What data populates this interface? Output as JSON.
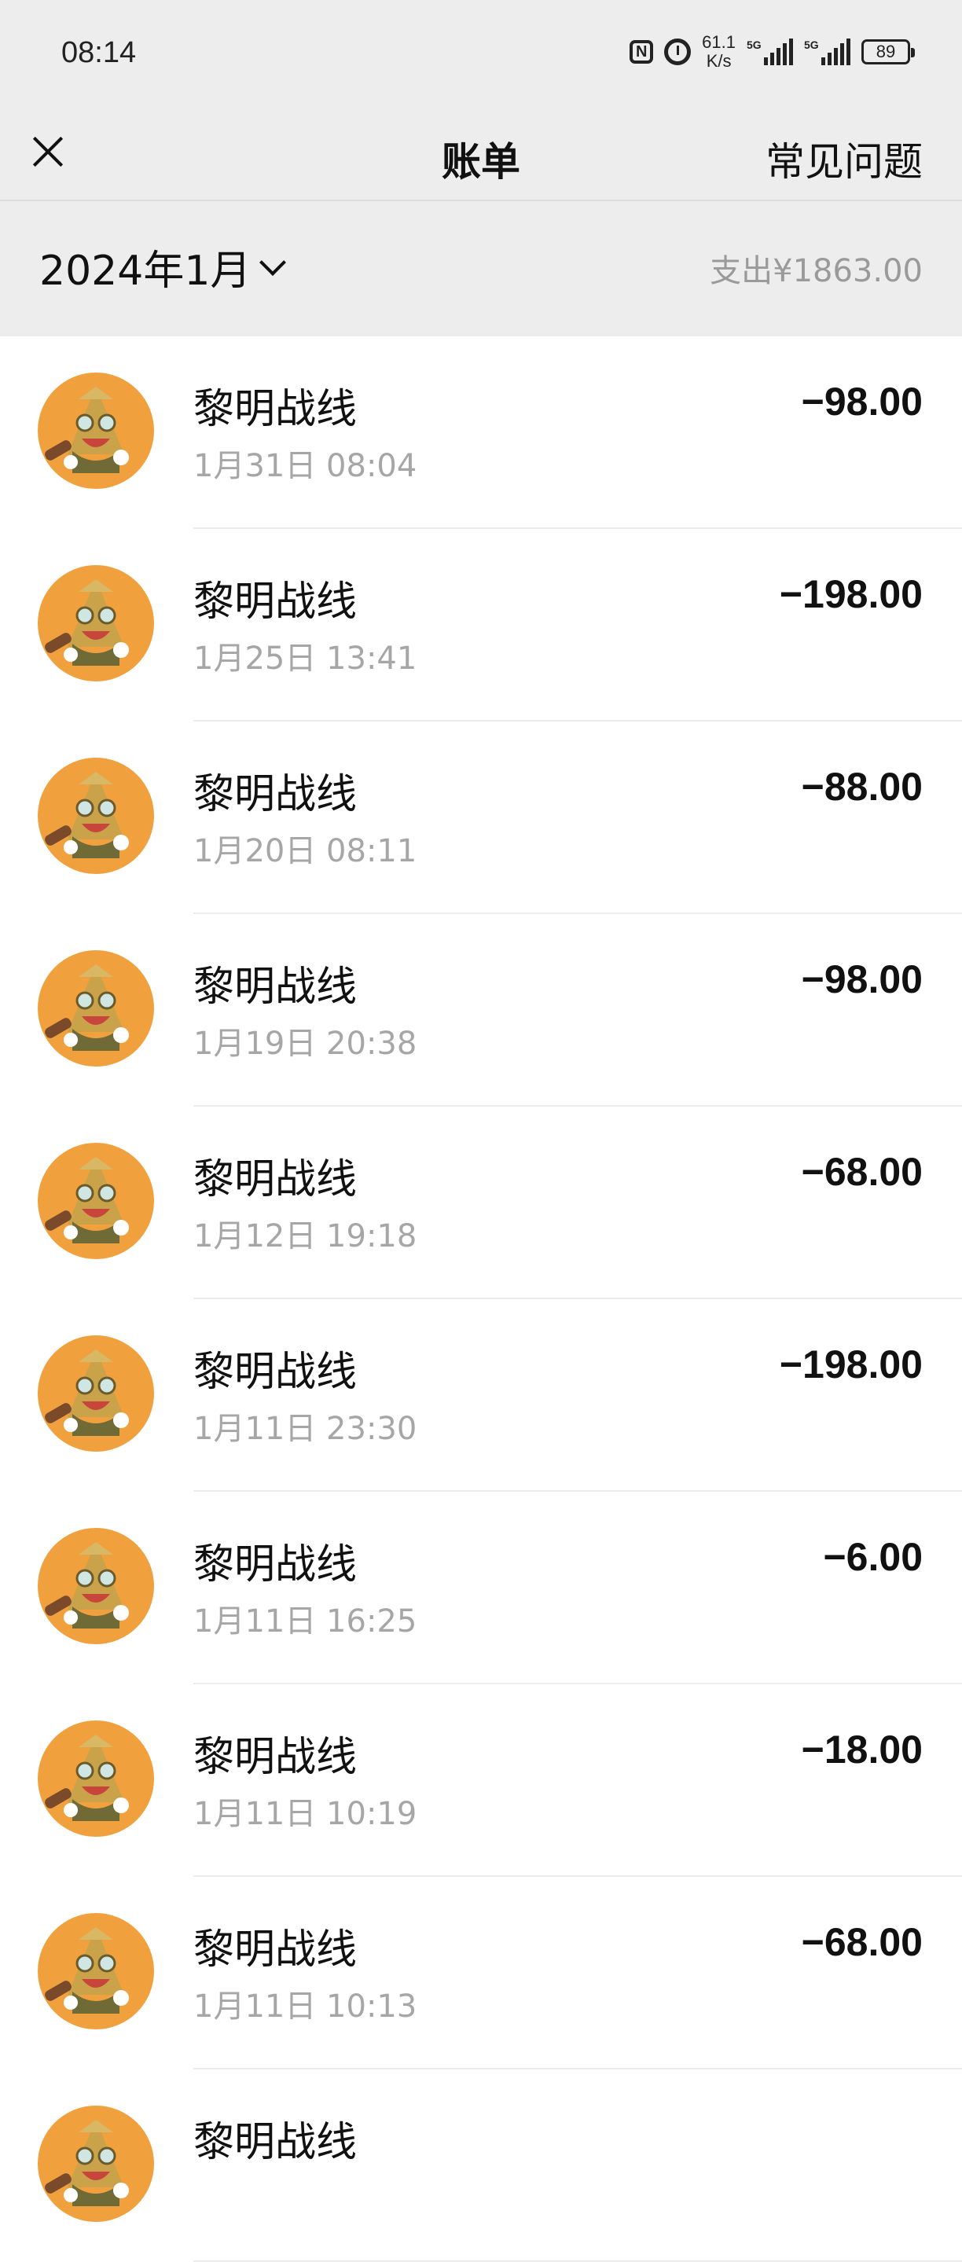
{
  "status_bar": {
    "time": "08:14",
    "net_speed_value": "61.1",
    "net_speed_unit": "K/s",
    "signal_1": "5G",
    "signal_2": "5G",
    "battery": "89"
  },
  "nav": {
    "title": "账单",
    "faq_label": "常见问题"
  },
  "month_header": {
    "month": "2024年1月",
    "expense_total": "支出¥1863.00"
  },
  "transactions": [
    {
      "merchant": "黎明战线",
      "datetime": "1月31日 08:04",
      "amount": "−98.00"
    },
    {
      "merchant": "黎明战线",
      "datetime": "1月25日 13:41",
      "amount": "−198.00"
    },
    {
      "merchant": "黎明战线",
      "datetime": "1月20日 08:11",
      "amount": "−88.00"
    },
    {
      "merchant": "黎明战线",
      "datetime": "1月19日 20:38",
      "amount": "−98.00"
    },
    {
      "merchant": "黎明战线",
      "datetime": "1月12日 19:18",
      "amount": "−68.00"
    },
    {
      "merchant": "黎明战线",
      "datetime": "1月11日 23:30",
      "amount": "−198.00"
    },
    {
      "merchant": "黎明战线",
      "datetime": "1月11日 16:25",
      "amount": "−6.00"
    },
    {
      "merchant": "黎明战线",
      "datetime": "1月11日 10:19",
      "amount": "−18.00"
    },
    {
      "merchant": "黎明战线",
      "datetime": "1月11日 10:13",
      "amount": "−68.00"
    },
    {
      "merchant": "黎明战线",
      "datetime": "",
      "amount": ""
    }
  ],
  "colors": {
    "header_bg": "#ededed",
    "avatar_orange": "#f0a13e",
    "secondary_text": "#a6a6a6"
  },
  "icons": {
    "close": "close-icon",
    "month_dropdown": "chevron-down-icon",
    "avatar": "game-mascot-avatar"
  }
}
